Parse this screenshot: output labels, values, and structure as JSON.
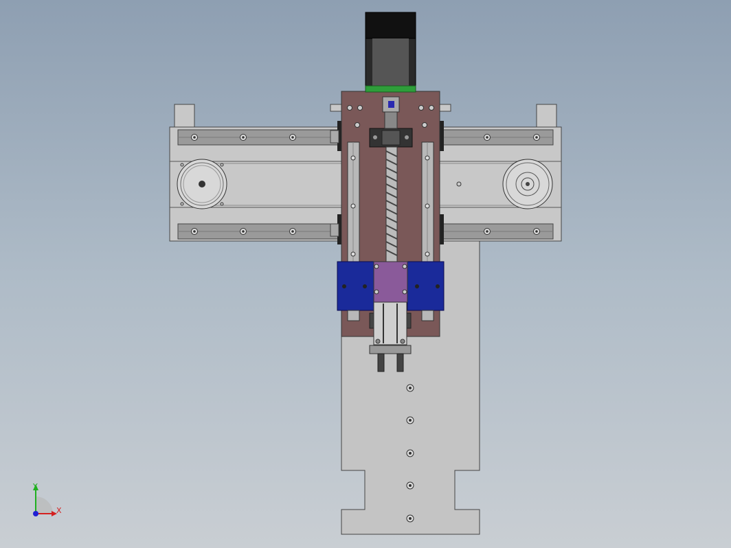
{
  "viewport": {
    "background_top": "#8e9fb2",
    "background_bottom": "#c9ced3"
  },
  "colors": {
    "steel": "#c8c8c8",
    "rail": "#9a9a9a",
    "carriage_plate": "#7a5858",
    "motor": "#1e1e1e",
    "coupling_band": "#2e9e3a",
    "slider_blocks": "#1a2a9a",
    "slider_center": "#8a5a9a"
  },
  "triad": {
    "x_label": "X",
    "y_label": "Y",
    "x_color": "#d42020",
    "y_color": "#20b020",
    "z_color": "#2020d4"
  }
}
